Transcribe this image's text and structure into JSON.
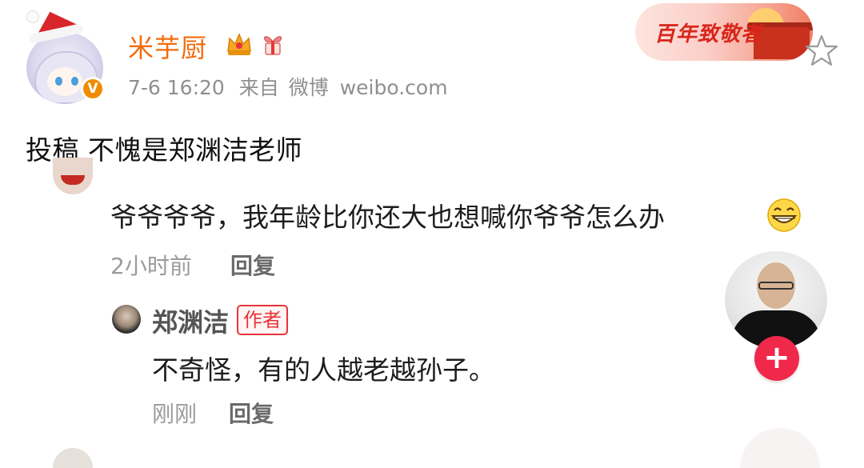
{
  "header": {
    "username": "米芋厨",
    "date": "7-6 16:20",
    "source_prefix": "来自",
    "source_app": "微博",
    "source_domain": "weibo.com",
    "verified_mark": "V",
    "promo_badge_text": "百年致敬者"
  },
  "post": {
    "text": "投稿 不愧是郑渊洁老师"
  },
  "embedded_screenshot": {
    "comment1": {
      "text": "爷爷爷爷，我年龄比你还大也想喊你爷爷怎么办",
      "time": "2小时前",
      "reply_label": "回复",
      "emoji": "grin-icon"
    },
    "comment2": {
      "author": "郑渊洁",
      "author_tag": "作者",
      "text": "不奇怪，有的人越老越孙子。",
      "time": "刚刚",
      "reply_label": "回复"
    },
    "follow_button_label": "+"
  },
  "colors": {
    "username": "#f26c0d",
    "meta": "#8f8f8f",
    "author_tag": "#e8333a",
    "follow_button": "#f0284a"
  }
}
